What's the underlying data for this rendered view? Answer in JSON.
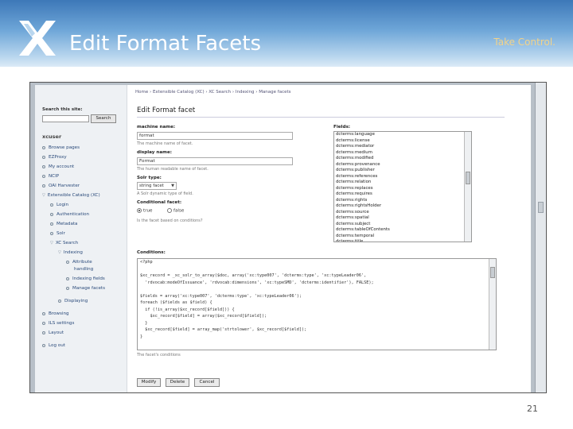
{
  "slide": {
    "title": "Edit Format Facets",
    "tagline": "Take Control.",
    "page_number": "21",
    "colors": {
      "banner_top": "#3d78b8",
      "banner_bottom": "#dcebf7",
      "tagline": "#f2d38a",
      "link": "#2a4a7a",
      "selected": "#3a78d4"
    }
  },
  "site": {
    "breadcrumb": "Home › Extensible Catalog (XC) › XC Search › Indexing › Manage facets",
    "search_label": "Search this site:",
    "search_value": "",
    "search_button": "Search",
    "user": "xcuser",
    "nav": [
      {
        "label": "Browse pages",
        "marker": "bullet"
      },
      {
        "label": "EZProxy",
        "marker": "bullet"
      },
      {
        "label": "My account",
        "marker": "bullet"
      },
      {
        "label": "NCIP",
        "marker": "bullet"
      },
      {
        "label": "OAI Harvester",
        "marker": "bullet"
      },
      {
        "label": "Extensible Catalog (XC)",
        "marker": "arrow"
      },
      {
        "label": "Login",
        "marker": "bullet"
      },
      {
        "label": "Authentication",
        "marker": "bullet"
      },
      {
        "label": "Metadata",
        "marker": "bullet"
      },
      {
        "label": "Solr",
        "marker": "bullet"
      },
      {
        "label": "XC Search",
        "marker": "arrow"
      },
      {
        "label": "Indexing",
        "marker": "arrow"
      },
      {
        "label": "Attribute",
        "marker": "bullet"
      },
      {
        "label": "handling",
        "marker": "none"
      },
      {
        "label": "Indexing fields",
        "marker": "bullet"
      },
      {
        "label": "Manage facets",
        "marker": "bullet"
      },
      {
        "label": "Displaying",
        "marker": "bullet"
      },
      {
        "label": "Browsing",
        "marker": "bullet"
      },
      {
        "label": "ILS settings",
        "marker": "bullet"
      },
      {
        "label": "Layout",
        "marker": "bullet"
      },
      {
        "label": "Log out",
        "marker": "bullet"
      }
    ]
  },
  "form": {
    "heading": "Edit Format facet",
    "machine_name_label": "machine name:",
    "machine_name_value": "format",
    "machine_name_desc": "The machine name of facet.",
    "display_name_label": "display name:",
    "display_name_value": "Format",
    "display_name_desc": "The human readable name of facet.",
    "solr_type_label": "Solr type:",
    "solr_type_value": "string facet",
    "solr_type_desc": "A Solr dynamic type of field.",
    "conditional_label": "Conditional facet:",
    "radio_true": "true",
    "radio_false": "false",
    "conditional_desc": "Is the facet based on conditions?",
    "fields_label": "Fields:",
    "fields": [
      "dcterms:language",
      "dcterms:license",
      "dcterms:mediator",
      "dcterms:medium",
      "dcterms:modified",
      "dcterms:provenance",
      "dcterms:publisher",
      "dcterms:references",
      "dcterms:relation",
      "dcterms:replaces",
      "dcterms:requires",
      "dcterms:rights",
      "dcterms:rightsHolder",
      "dcterms:source",
      "dcterms:spatial",
      "dcterms:subject",
      "dcterms:tableOfContents",
      "dcterms:temporal",
      "dcterms:title",
      "dcterms:type"
    ],
    "fields_selected": "dcterms:type",
    "conditions_label": "Conditions:",
    "conditions": [
      "<?php",
      "",
      "$xc_record = _xc_solr_to_array($doc, array('xc:type007', 'dcterms:type', 'xc:typeLeader06',",
      "  'rdvocab:modeOfIssuance', 'rdvocab:dimensions', 'xc:typeSMD', 'dcterms:identifier'), FALSE);",
      "",
      "$fields = array('xc:type007', 'dcterms:type', 'xc:typeLeader06');",
      "foreach ($fields as $field) {",
      "  if (!is_array($xc_record[$field])) {",
      "    $xc_record[$field] = array($xc_record[$field]);",
      "  }",
      "  $xc_record[$field] = array_map('strtolower', $xc_record[$field]);",
      "}"
    ],
    "conditions_desc": "The facet's conditions",
    "buttons": {
      "modify": "Modify",
      "delete": "Delete",
      "cancel": "Cancel"
    }
  }
}
